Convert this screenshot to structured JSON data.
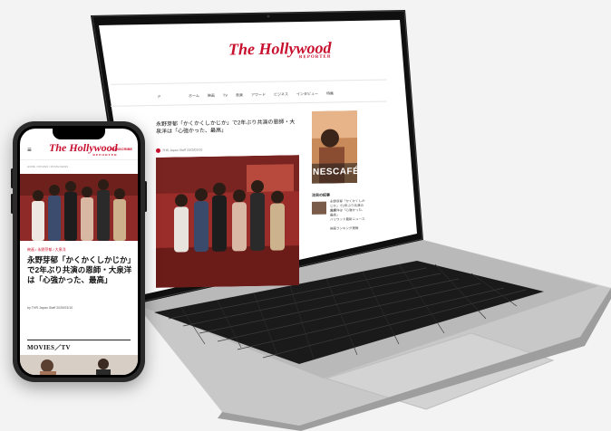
{
  "laptop": {
    "logo": "The Hollywood",
    "logo_sub": "REPORTER",
    "nav": [
      "ホーム",
      "映画",
      "TV",
      "音楽",
      "アワード",
      "ビジネス",
      "インタビュー",
      "特集"
    ],
    "headline": "永野芽郁「かくかくしかじか」で2年ぶり共演の恩師・大泉洋は「心強かった、最高」",
    "meta": "THR Japan Staff  2025/03/10",
    "ad_text": "NESCAFÉ",
    "side_title": "注目の記事",
    "side_items": [
      "永野芽郁「かくかくしかじか」で2年ぶり共演の恩師",
      "大泉洋は「心強かった、最高」",
      "ハリウッド最新ニュース",
      "映画ランキング速報"
    ]
  },
  "phone": {
    "menu_icon": "≡",
    "logo": "The Hollywood",
    "logo_sub": "REPORTER",
    "subscribe": "SUBSCRIBE",
    "breadcrumb": "HOME / MOVIES / MOVIE NEWS",
    "kicker": "映画 / 永野芽郁 / 大泉洋",
    "headline": "永野芽郁「かくかくしかじか」で2年ぶり共演の恩師・大泉洋は「心強かった、最高」",
    "byline": "by THR Japan Staff  2025/03/10",
    "section": "MOVIES／TV"
  },
  "colors": {
    "brand": "#c8102e",
    "frame": "#111111",
    "base": "#c9c9c9"
  }
}
